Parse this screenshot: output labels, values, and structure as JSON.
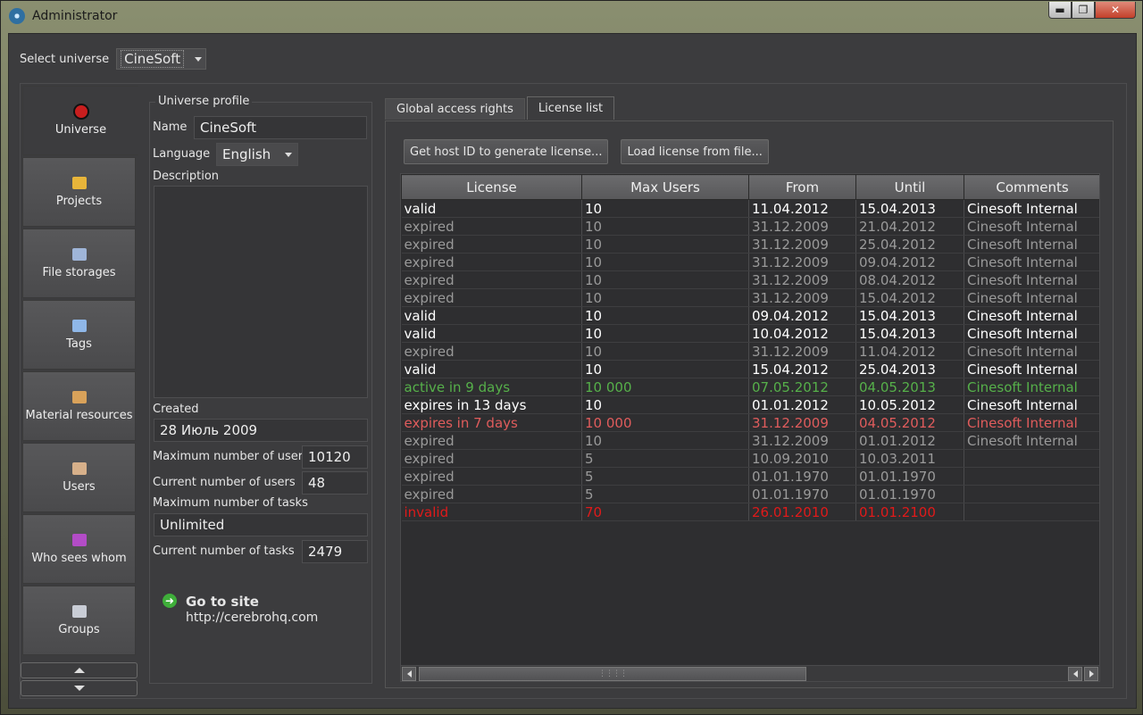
{
  "window": {
    "title": "Administrator",
    "minimize": "▬",
    "maximize": "❐",
    "close": "✕"
  },
  "universe": {
    "label": "Select universe",
    "selected": "CineSoft"
  },
  "sidebar": {
    "items": [
      {
        "label": "Universe",
        "icon": "universe-icon",
        "color": "#c81e1e"
      },
      {
        "label": "Projects",
        "icon": "folder-icon",
        "color": "#e8b53a"
      },
      {
        "label": "File storages",
        "icon": "storage-icon",
        "color": "#9fb5d8"
      },
      {
        "label": "Tags",
        "icon": "tag-icon",
        "color": "#8fb7e8"
      },
      {
        "label": "Material resources",
        "icon": "box-icon",
        "color": "#d9a25a"
      },
      {
        "label": "Users",
        "icon": "user-icon",
        "color": "#d7b08a"
      },
      {
        "label": "Who sees whom",
        "icon": "eye-icon",
        "color": "#b34cc7"
      },
      {
        "label": "Groups",
        "icon": "groups-icon",
        "color": "#c9cdd6"
      }
    ]
  },
  "profile": {
    "title": "Universe profile",
    "name_label": "Name",
    "name": "CineSoft",
    "language_label": "Language",
    "language": "English",
    "description_label": "Description",
    "created_label": "Created",
    "created": "28 Июль 2009",
    "max_users_label": "Maximum number of users",
    "max_users": "10120",
    "cur_users_label": "Current number of users",
    "cur_users": "48",
    "max_tasks_label": "Maximum number of tasks",
    "max_tasks": "Unlimited",
    "cur_tasks_label": "Current number of tasks",
    "cur_tasks": "2479",
    "goto_title": "Go to site",
    "goto_url": "http://cerebrohq.com"
  },
  "tabs": [
    {
      "label": "Global access rights"
    },
    {
      "label": "License list"
    }
  ],
  "buttons": {
    "get_host": "Get host ID to generate license...",
    "load_license": "Load license from file..."
  },
  "table": {
    "columns": [
      "License",
      "Max Users",
      "From",
      "Until",
      "Comments"
    ],
    "rows": [
      [
        "valid",
        "10",
        "11.04.2012",
        "15.04.2013",
        "Cinesoft Internal"
      ],
      [
        "expired",
        "10",
        "31.12.2009",
        "21.04.2012",
        "Cinesoft Internal"
      ],
      [
        "expired",
        "10",
        "31.12.2009",
        "25.04.2012",
        "Cinesoft Internal"
      ],
      [
        "expired",
        "10",
        "31.12.2009",
        "09.04.2012",
        "Cinesoft Internal"
      ],
      [
        "expired",
        "10",
        "31.12.2009",
        "08.04.2012",
        "Cinesoft Internal"
      ],
      [
        "expired",
        "10",
        "31.12.2009",
        "15.04.2012",
        "Cinesoft Internal"
      ],
      [
        "valid",
        "10",
        "09.04.2012",
        "15.04.2013",
        "Cinesoft Internal"
      ],
      [
        "valid",
        "10",
        "10.04.2012",
        "15.04.2013",
        "Cinesoft Internal"
      ],
      [
        "expired",
        "10",
        "31.12.2009",
        "11.04.2012",
        "Cinesoft Internal"
      ],
      [
        "valid",
        "10",
        "15.04.2012",
        "25.04.2013",
        "Cinesoft Internal"
      ],
      [
        "active in 9 days",
        "10 000",
        "07.05.2012",
        "04.05.2013",
        "Cinesoft Internal"
      ],
      [
        "expires in 13 days",
        "10",
        "01.01.2012",
        "10.05.2012",
        "Cinesoft Internal"
      ],
      [
        "expires in 7 days",
        "10 000",
        "31.12.2009",
        "04.05.2012",
        "Cinesoft Internal"
      ],
      [
        "expired",
        "10",
        "31.12.2009",
        "01.01.2012",
        "Cinesoft Internal"
      ],
      [
        "expired",
        "5",
        "10.09.2010",
        "10.03.2011",
        ""
      ],
      [
        "expired",
        "5",
        "01.01.1970",
        "01.01.1970",
        ""
      ],
      [
        "expired",
        "5",
        "01.01.1970",
        "01.01.1970",
        ""
      ],
      [
        "invalid",
        "70",
        "26.01.2010",
        "01.01.2100",
        ""
      ]
    ],
    "row_status": [
      "valid",
      "expired",
      "expired",
      "expired",
      "expired",
      "expired",
      "valid",
      "valid",
      "expired",
      "valid",
      "active",
      "soon",
      "expiring",
      "expired",
      "expired",
      "expired",
      "expired",
      "invalid"
    ]
  }
}
